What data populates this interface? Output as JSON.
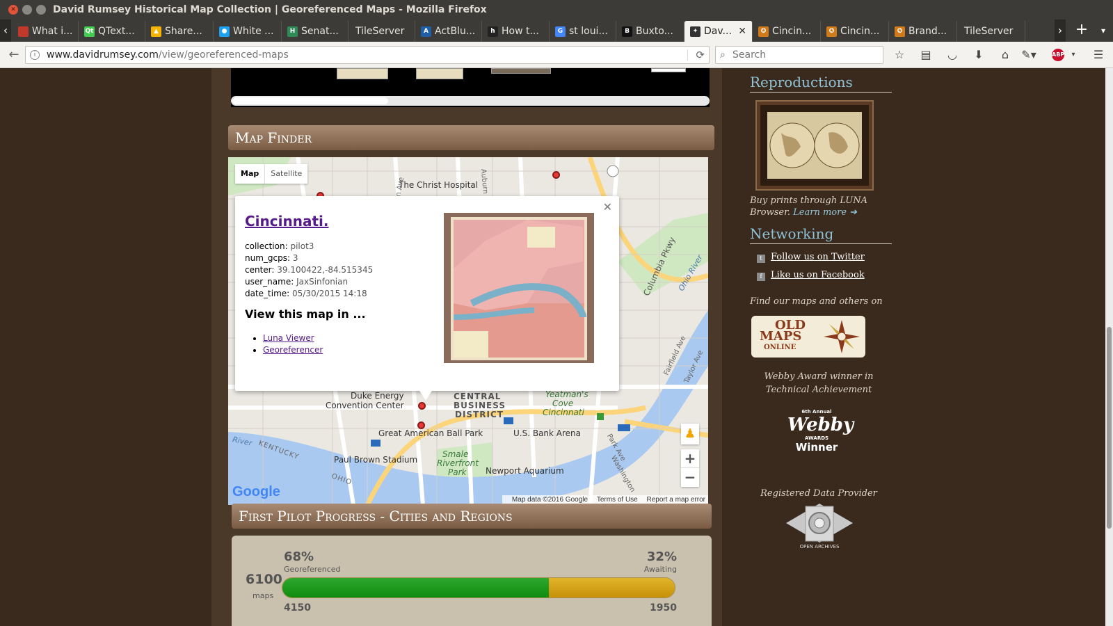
{
  "window": {
    "title": "David Rumsey Historical Map Collection | Georeferenced Maps - Mozilla Firefox"
  },
  "tabs": [
    {
      "label": "What i...",
      "icon": "red-favicon",
      "color": "#c0392b"
    },
    {
      "label": "QText...",
      "icon": "qt-icon",
      "color": "#41cd52"
    },
    {
      "label": "Share...",
      "icon": "google-drive-icon",
      "color": "#f4b400"
    },
    {
      "label": "White ...",
      "icon": "blue-circle-icon",
      "color": "#1da1f2"
    },
    {
      "label": "Senat...",
      "icon": "h-icon",
      "color": "#2e8b57"
    },
    {
      "label": "TileServer",
      "icon": "",
      "color": ""
    },
    {
      "label": "ActBlu...",
      "icon": "actblue-icon",
      "color": "#1f5fa8"
    },
    {
      "label": "How t...",
      "icon": "htg-icon",
      "color": "#222222"
    },
    {
      "label": "st loui...",
      "icon": "google-icon",
      "color": "#4285f4"
    },
    {
      "label": "Buxto...",
      "icon": "big-icon",
      "color": "#111111"
    },
    {
      "label": "Dav...",
      "icon": "star-icon",
      "color": "#333333",
      "active": true
    },
    {
      "label": "Cincin...",
      "icon": "compass-icon",
      "color": "#d07a1a"
    },
    {
      "label": "Cincin...",
      "icon": "compass-icon",
      "color": "#d07a1a"
    },
    {
      "label": "Brand...",
      "icon": "compass-icon",
      "color": "#d07a1a"
    },
    {
      "label": "TileServer",
      "icon": "",
      "color": ""
    }
  ],
  "navbar": {
    "url_host": "www.davidrumsey.com",
    "url_path": "/view/georeferenced-maps",
    "search_placeholder": "Search"
  },
  "map_finder": {
    "title": "Map Finder",
    "map_type": {
      "map": "Map",
      "satellite": "Satellite"
    },
    "labels": {
      "christ_hospital": "The Christ Hospital",
      "duke_energy": "Duke Energy",
      "convention_center": "Convention Center",
      "central": "CENTRAL",
      "business": "BUSINESS",
      "district": "DISTRICT",
      "yeatmans": "Yeatman's",
      "cove": "Cove",
      "cincinnati": "Cincinnati",
      "ballpark": "Great American Ball Park",
      "usbank": "U.S. Bank Arena",
      "paul_brown": "Paul Brown Stadium",
      "smale1": "Smale",
      "smale2": "Riverfront",
      "smale3": "Park",
      "aquarium": "Newport Aquarium",
      "ohio_river": "Ohio River",
      "river": "River",
      "kentucky": "KENTUCKY",
      "ohio": "OHIO",
      "columbia": "Columbia Pkwy",
      "auburn": "Auburn Ave",
      "clifton": "Clifton Ave",
      "fairfield": "Fairfield Ave",
      "taylor": "Taylor Ave",
      "park_ave": "Park Ave",
      "washington": "Washington"
    },
    "info_window": {
      "title": "Cincinnati.",
      "fields": [
        {
          "key": "collection:",
          "value": "pilot3"
        },
        {
          "key": "num_gcps:",
          "value": "3"
        },
        {
          "key": "center:",
          "value": "39.100422,-84.515345"
        },
        {
          "key": "user_name:",
          "value": "JaxSinfonian"
        },
        {
          "key": "date_time:",
          "value": "05/30/2015 14:18"
        }
      ],
      "view_heading": "View this map in ...",
      "links": [
        "Luna Viewer",
        "Georeferencer"
      ]
    },
    "google": "Google",
    "attribution": {
      "data": "Map data ©2016 Google",
      "terms": "Terms of Use",
      "report": "Report a map error"
    }
  },
  "pilot": {
    "title": "First Pilot Progress - Cities and Regions",
    "total": "6100",
    "total_label": "maps",
    "georeferenced_pct": "68%",
    "georeferenced_label": "Georeferenced",
    "awaiting_pct": "32%",
    "awaiting_label": "Awaiting",
    "georeferenced_count": "4150",
    "awaiting_count": "1950",
    "progress_fraction": 0.68,
    "colors": {
      "done": "#1a961a",
      "awaiting": "#d4a017"
    }
  },
  "sidebar": {
    "reproductions": "Reproductions",
    "buy_text": "Buy prints through LUNA Browser.",
    "learn_more": "Learn more ➔",
    "networking": "Networking",
    "twitter": "Follow us on Twitter",
    "facebook": "Like us on Facebook",
    "find_maps": "Find our maps and others on",
    "oldmaps1": "OLD",
    "oldmaps2": "MAPS",
    "oldmaps3": "ONLINE",
    "webby_text": "Webby Award winner in Technical Achievement",
    "webby_annual": "6th Annual",
    "webby_word": "Webby",
    "webby_awards": "AWARDS",
    "webby_winner": "Winner",
    "registered": "Registered Data Provider",
    "open_archives": "OPEN ARCHIVES"
  }
}
